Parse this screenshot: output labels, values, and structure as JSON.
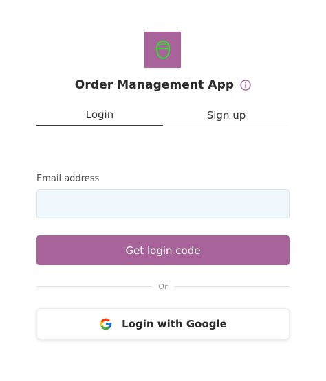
{
  "app": {
    "title": "Order Management App",
    "logo_icon": "user-avatar-icon",
    "info_icon": "info-circle-icon"
  },
  "tabs": [
    {
      "label": "Login",
      "active": true
    },
    {
      "label": "Sign up",
      "active": false
    }
  ],
  "form": {
    "email_label": "Email address",
    "email_value": "",
    "email_placeholder": "",
    "submit_label": "Get login code"
  },
  "divider": {
    "text": "Or"
  },
  "google": {
    "label": "Login with Google",
    "icon": "google-icon"
  },
  "colors": {
    "accent": "#a8649a",
    "logo_glyph": "#3ed13e",
    "input_bg": "#f0f7fd"
  }
}
